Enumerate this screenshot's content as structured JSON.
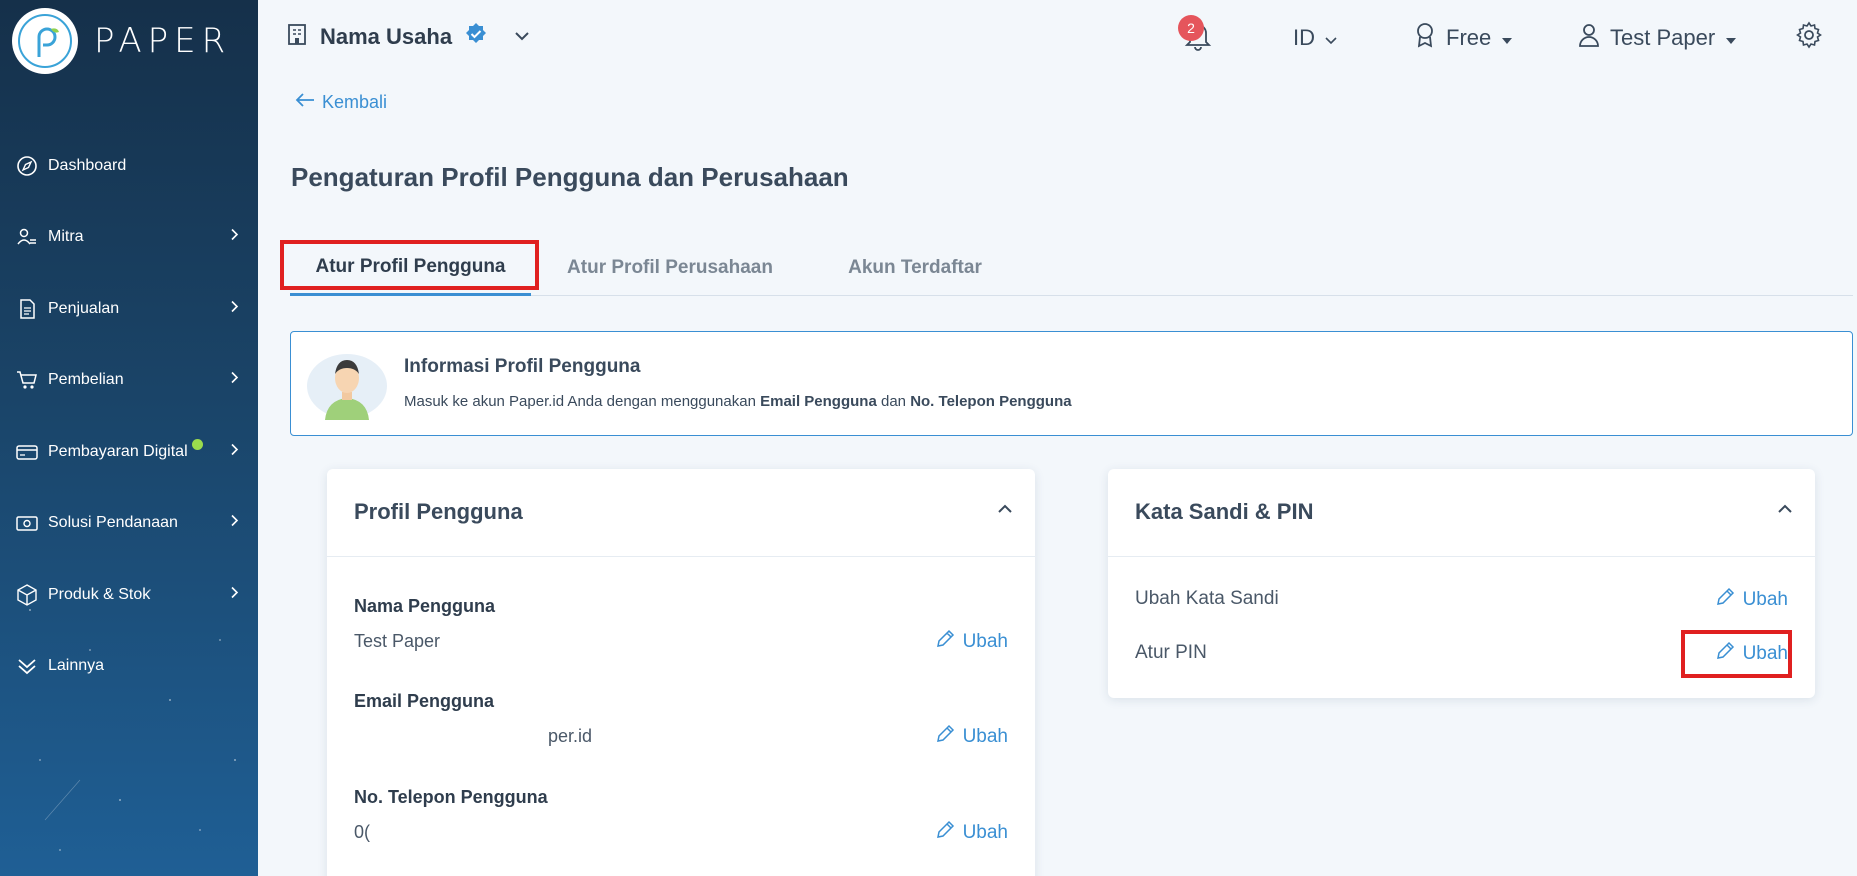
{
  "app": {
    "logo_text": "PAPER"
  },
  "sidebar": {
    "items": [
      {
        "label": "Dashboard"
      },
      {
        "label": "Mitra"
      },
      {
        "label": "Penjualan"
      },
      {
        "label": "Pembelian"
      },
      {
        "label": "Pembayaran Digital"
      },
      {
        "label": "Solusi Pendanaan"
      },
      {
        "label": "Produk & Stok"
      },
      {
        "label": "Lainnya"
      }
    ]
  },
  "header": {
    "business_name": "Nama Usaha",
    "notification_count": "2",
    "language": "ID",
    "plan": "Free",
    "user_name": "Test Paper"
  },
  "back_label": "Kembali",
  "page_title": "Pengaturan Profil Pengguna dan Perusahaan",
  "tabs": [
    {
      "label": "Atur Profil Pengguna"
    },
    {
      "label": "Atur Profil Perusahaan"
    },
    {
      "label": "Akun Terdaftar"
    }
  ],
  "info": {
    "title": "Informasi Profil Pengguna",
    "desc_prefix": "Masuk ke akun Paper.id Anda dengan menggunakan ",
    "desc_bold1": "Email Pengguna",
    "desc_mid": " dan ",
    "desc_bold2": "No. Telepon Pengguna"
  },
  "profile_card": {
    "title": "Profil Pengguna",
    "fields": [
      {
        "label": "Nama Pengguna",
        "value": "Test Paper",
        "action": "Ubah"
      },
      {
        "label": "Email Pengguna",
        "value": "per.id",
        "action": "Ubah"
      },
      {
        "label": "No. Telepon Pengguna",
        "value": "0(",
        "action": "Ubah"
      }
    ]
  },
  "security_card": {
    "title": "Kata Sandi & PIN",
    "rows": [
      {
        "label": "Ubah Kata Sandi",
        "action": "Ubah"
      },
      {
        "label": "Atur PIN",
        "action": "Ubah"
      }
    ]
  },
  "colors": {
    "accent": "#3a8fd3",
    "highlight": "#e02020",
    "sidebar": "#1a4468",
    "online_dot": "#9bdb4d"
  }
}
